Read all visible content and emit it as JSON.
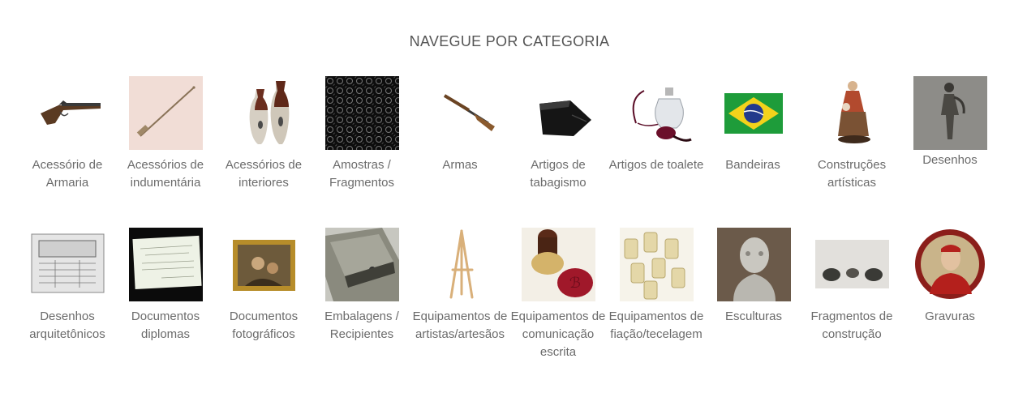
{
  "section": {
    "title": "NAVEGUE POR CATEGORIA"
  },
  "categories": [
    {
      "label": "Acessório de Armaria",
      "icon": "flintlock-pistol-icon"
    },
    {
      "label": "Acessórios de indumentária",
      "icon": "hatpin-icon"
    },
    {
      "label": "Acessórios de interiores",
      "icon": "vases-icon"
    },
    {
      "label": "Amostras / Fragmentos",
      "icon": "lace-fabric-icon"
    },
    {
      "label": "Armas",
      "icon": "rifle-icon"
    },
    {
      "label": "Artigos de tabagismo",
      "icon": "tobacco-pouch-icon"
    },
    {
      "label": "Artigos de toalete",
      "icon": "perfume-atomizer-icon"
    },
    {
      "label": "Bandeiras",
      "icon": "brazil-flag-icon"
    },
    {
      "label": "Construções artísticas",
      "icon": "figurine-icon"
    },
    {
      "label": "Desenhos",
      "icon": "figure-drawing-icon"
    },
    {
      "label": "Desenhos arquitetônicos",
      "icon": "architectural-plan-icon"
    },
    {
      "label": "Documentos diplomas",
      "icon": "diploma-icon"
    },
    {
      "label": "Documentos fotográficos",
      "icon": "framed-photo-icon"
    },
    {
      "label": "Embalagens / Recipientes",
      "icon": "tin-box-icon"
    },
    {
      "label": "Equipamentos de artistas/artesãos",
      "icon": "easel-icon"
    },
    {
      "label": "Equipamentos de comunicação escrita",
      "icon": "wax-seal-icon"
    },
    {
      "label": "Equipamentos de fiação/tecelagem",
      "icon": "spools-icon"
    },
    {
      "label": "Esculturas",
      "icon": "bust-sculpture-icon"
    },
    {
      "label": "Fragmentos de construção",
      "icon": "building-fragments-icon"
    },
    {
      "label": "Gravuras",
      "icon": "portrait-engraving-icon"
    }
  ]
}
